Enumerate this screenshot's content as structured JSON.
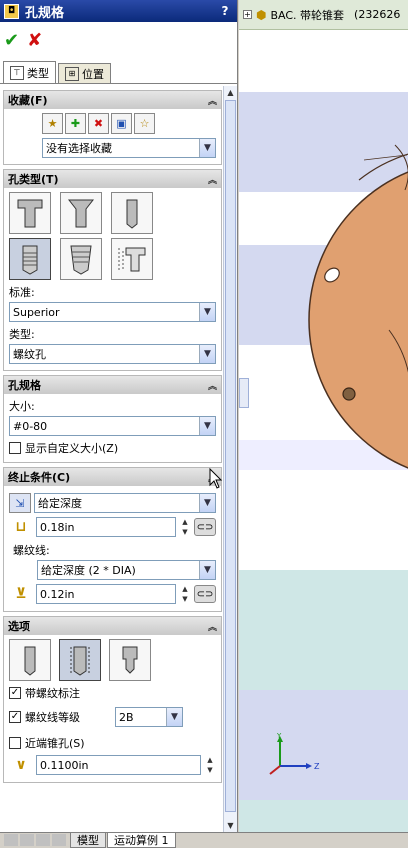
{
  "window": {
    "title": "孔规格",
    "help": "?"
  },
  "actions": {
    "ok": "✔",
    "cancel": "✘"
  },
  "tabs": [
    {
      "label": "类型",
      "active": true
    },
    {
      "label": "位置",
      "active": false
    }
  ],
  "favorites": {
    "header": "收藏(F)",
    "select_value": "没有选择收藏",
    "icons": [
      "favorite-apply-icon",
      "favorite-add-icon",
      "favorite-delete-icon",
      "favorite-save-icon",
      "favorite-load-icon"
    ]
  },
  "hole_type": {
    "header": "孔类型(T)",
    "buttons_row1": [
      "counterbore-icon",
      "countersink-icon",
      "hole-icon"
    ],
    "buttons_row2": [
      "straight-tap-icon",
      "tapered-tap-icon",
      "legacy-hole-icon"
    ],
    "standard_label": "标准:",
    "standard_value": "Superior",
    "type_label": "类型:",
    "type_value": "螺纹孔"
  },
  "hole_spec": {
    "header": "孔规格",
    "size_label": "大小:",
    "size_value": "#0-80",
    "custom_size_label": "显示自定义大小(Z)",
    "custom_size_checked": false
  },
  "end_condition": {
    "header": "终止条件(C)",
    "condition_value": "给定深度",
    "depth_value": "0.18in",
    "thread_label": "螺纹线:",
    "thread_value": "给定深度 (2 * DIA)",
    "thread_depth_value": "0.12in"
  },
  "options": {
    "header": "选项",
    "buttons": [
      "cosmetic-thread-icon",
      "thread-with-callout-icon",
      "remove-thread-icon"
    ],
    "cosmetic_label": "带螺纹标注",
    "cosmetic_checked": true,
    "thread_class_label": "螺纹线等级",
    "thread_class_checked": true,
    "thread_class_value": "2B",
    "near_csink_label": "近端锥孔(S)",
    "near_csink_checked": false,
    "near_csink_value": "0.1100in"
  },
  "tree": {
    "node_label": "BAC. 带轮锥套",
    "node_suffix": "(232626"
  },
  "bottom_tabs": [
    {
      "label": "模型",
      "active": false
    },
    {
      "label": "运动算例 1",
      "active": true
    }
  ],
  "colors": {
    "part": "#e0a070",
    "title_bar": "#0b2a7a",
    "ok": "#1a9a1a",
    "cancel": "#d01010"
  }
}
